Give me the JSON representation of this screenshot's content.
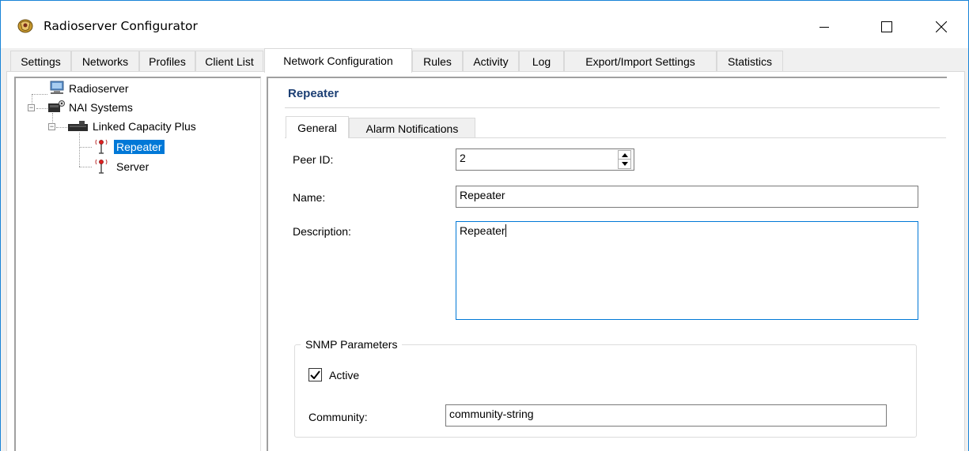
{
  "window": {
    "title": "Radioserver Configurator",
    "icon": "radioserver-app-icon",
    "controls": {
      "minimize": "minimize-icon",
      "maximize": "maximize-icon",
      "close": "close-icon"
    }
  },
  "tabs": [
    {
      "label": "Settings"
    },
    {
      "label": "Networks"
    },
    {
      "label": "Profiles"
    },
    {
      "label": "Client List"
    },
    {
      "label": "Network Configuration",
      "active": true
    },
    {
      "label": "Rules"
    },
    {
      "label": "Activity"
    },
    {
      "label": "Log"
    },
    {
      "label": "Export/Import Settings"
    },
    {
      "label": "Statistics"
    }
  ],
  "tree": {
    "nodes": [
      {
        "label": "Radioserver",
        "icon": "monitor-icon"
      },
      {
        "label": "NAI Systems",
        "icon": "network-systems-icon"
      },
      {
        "label": "Linked Capacity Plus",
        "icon": "capacity-system-icon"
      },
      {
        "label": "Repeater",
        "icon": "antenna-icon",
        "selected": true
      },
      {
        "label": "Server",
        "icon": "antenna-icon"
      }
    ]
  },
  "detail": {
    "title": "Repeater",
    "subtabs": [
      {
        "label": "General",
        "active": true
      },
      {
        "label": "Alarm Notifications"
      }
    ],
    "fields": {
      "peer_id_label": "Peer ID:",
      "peer_id_value": "2",
      "name_label": "Name:",
      "name_value": "Repeater",
      "description_label": "Description:",
      "description_value": "Repeater"
    },
    "snmp": {
      "group_title": "SNMP Parameters",
      "active_label": "Active",
      "active_checked": true,
      "community_label": "Community:",
      "community_value": "community-string"
    }
  },
  "colors": {
    "accent": "#0078d7",
    "section_title": "#1c3f74",
    "window_border": "#1883d7"
  }
}
